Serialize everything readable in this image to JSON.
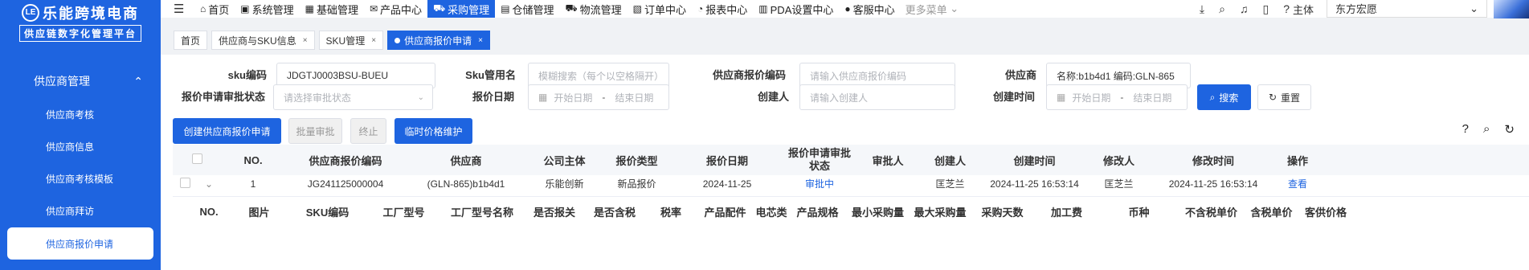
{
  "brand": {
    "logo_mark": "LE",
    "title": "乐能跨境电商",
    "subtitle": "供应链数字化管理平台"
  },
  "sidebar": {
    "group_label": "供应商管理",
    "group_chevron": "⌃",
    "items": [
      {
        "label": "供应商考核"
      },
      {
        "label": "供应商信息"
      },
      {
        "label": "供应商考核模板"
      },
      {
        "label": "供应商拜访"
      },
      {
        "label": "供应商报价申请"
      }
    ]
  },
  "topnav": {
    "hamburger": "☰",
    "items": [
      {
        "icon": "⌂",
        "label": "首页"
      },
      {
        "icon": "▣",
        "label": "系统管理"
      },
      {
        "icon": "▦",
        "label": "基础管理"
      },
      {
        "icon": "✉",
        "label": "产品中心"
      },
      {
        "icon": "⛟",
        "label": "采购管理"
      },
      {
        "icon": "▤",
        "label": "仓储管理"
      },
      {
        "icon": "⛟",
        "label": "物流管理"
      },
      {
        "icon": "▧",
        "label": "订单中心"
      },
      {
        "icon": "◔",
        "label": "报表中心"
      },
      {
        "icon": "▥",
        "label": "PDA设置中心"
      },
      {
        "icon": "●",
        "label": "客服中心"
      }
    ],
    "more_label": "更多菜单",
    "more_chevron": "⌄",
    "right": {
      "download_icon": "⤓",
      "search_icon": "⌕",
      "bell_icon": "♫",
      "message_icon": "▯",
      "help_icon": "?",
      "subject_label": "主体",
      "company_value": "东方宏愿",
      "company_chevron": "⌄"
    }
  },
  "tabs": [
    {
      "label": "首页",
      "closable": false,
      "active": false
    },
    {
      "label": "供应商与SKU信息",
      "closable": true,
      "active": false
    },
    {
      "label": "SKU管理",
      "closable": true,
      "active": false
    },
    {
      "label": "供应商报价申请",
      "closable": true,
      "active": true
    }
  ],
  "tab_close": "×",
  "filters": {
    "sku_code_label": "sku编码",
    "sku_code_value": "JDGTJ0003BSU-BUEU",
    "sku_name_label": "Sku管用名",
    "sku_name_placeholder": "模糊搜索（每个以空格隔开）",
    "quote_code_label": "供应商报价编码",
    "quote_code_placeholder": "请输入供应商报价编码",
    "supplier_label": "供应商",
    "supplier_value": "名称:b1b4d1  编码:GLN-865",
    "approval_status_label": "报价申请审批状态",
    "approval_status_placeholder": "请选择审批状态",
    "quote_date_label": "报价日期",
    "date_start_placeholder": "开始日期",
    "date_sep": "-",
    "date_end_placeholder": "结束日期",
    "creator_label": "创建人",
    "creator_placeholder": "请输入创建人",
    "create_time_label": "创建时间",
    "search_label": "搜索",
    "reset_label": "重置"
  },
  "actions": {
    "create_label": "创建供应商报价申请",
    "batch_approve_label": "批量审批",
    "terminate_label": "终止",
    "temp_price_label": "临时价格维护"
  },
  "table": {
    "headers": [
      "NO.",
      "供应商报价编码",
      "供应商",
      "公司主体",
      "报价类型",
      "报价日期",
      "报价申请审批状态",
      "审批人",
      "创建人",
      "创建时间",
      "修改人",
      "修改时间",
      "操作"
    ],
    "rows": [
      {
        "no": "1",
        "quote_code": "JG241125000004",
        "supplier": "(GLN-865)b1b4d1",
        "company": "乐能创新",
        "quote_type": "新品报价",
        "quote_date": "2024-11-25",
        "status": "审批中",
        "approver": "",
        "creator": "匡芝兰",
        "create_time": "2024-11-25 16:53:14",
        "modifier": "匡芝兰",
        "modify_time": "2024-11-25 16:53:14",
        "action": "查看"
      }
    ],
    "expand_icon": "⌄",
    "sub_headers": [
      "NO.",
      "图片",
      "SKU编码",
      "工厂型号",
      "工厂型号名称",
      "是否报关",
      "是否含税",
      "税率",
      "产品配件",
      "电芯类",
      "产品规格",
      "最小采购量",
      "最大采购量",
      "采购天数",
      "加工费",
      "币种",
      "不含税单价",
      "含税单价",
      "客供价格"
    ]
  },
  "toolbar_icons": {
    "help": "?",
    "search": "⌕",
    "refresh": "↻"
  }
}
